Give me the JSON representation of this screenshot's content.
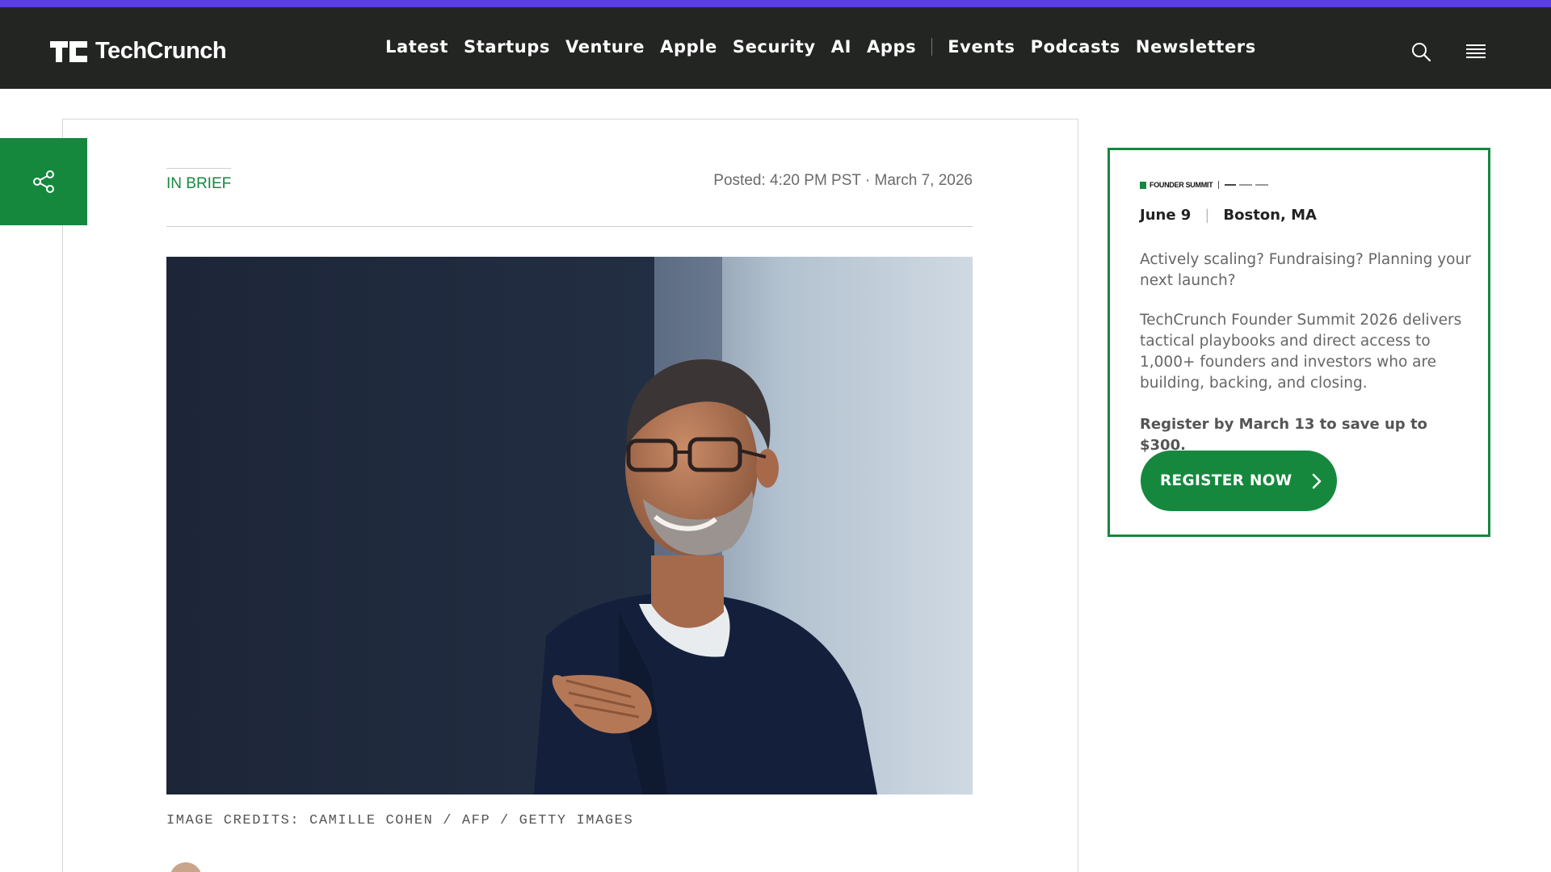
{
  "site": {
    "name": "TechCrunch",
    "accent_color": "#5b3ee6",
    "brand_green": "#15883e",
    "header_bg": "#232523"
  },
  "nav": {
    "items": [
      "Latest",
      "Startups",
      "Venture",
      "Apple",
      "Security",
      "AI",
      "Apps"
    ],
    "secondary": [
      "Events",
      "Podcasts",
      "Newsletters"
    ],
    "search_icon": "search-icon",
    "menu_icon": "hamburger-menu-icon"
  },
  "article": {
    "category": "IN BRIEF",
    "posted": "Posted: 4:20 PM PST · March 7, 2026",
    "image_credits": "IMAGE CREDITS: CAMILLE COHEN / AFP / GETTY IMAGES",
    "share_icon": "share-icon"
  },
  "promo": {
    "logo_text": "FOUNDER SUMMIT",
    "date": "June 9",
    "location": "Boston, MA",
    "para1": "Actively scaling? Fundraising? Planning your next launch?",
    "para2": "TechCrunch Founder Summit 2026 delivers tactical playbooks and direct access to 1,000+ founders and investors who are building, backing, and closing.",
    "para3": "Register by March 13 to save up to $300.",
    "cta": "REGISTER NOW",
    "cta_icon": "chevron-right-icon"
  }
}
